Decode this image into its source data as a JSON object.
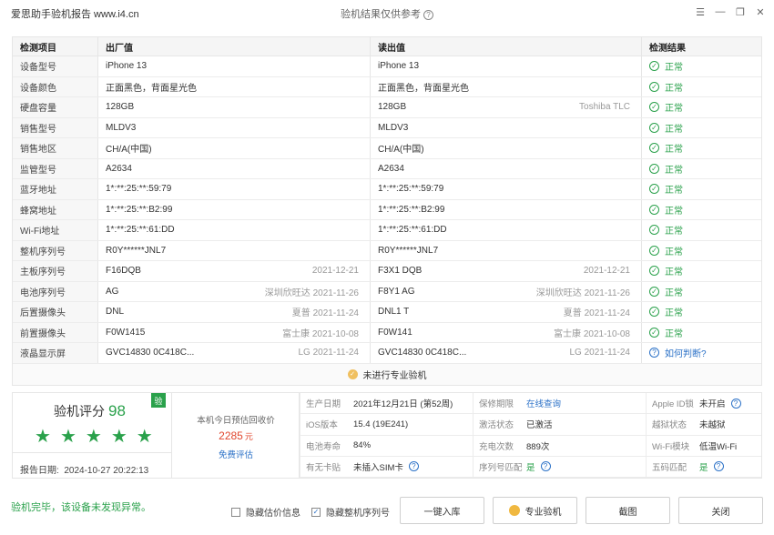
{
  "window": {
    "app_title": "爱思助手验机报告 www.i4.cn",
    "center_title": "验机结果仅供参考",
    "controls": [
      "☰",
      "—",
      "❐",
      "✕"
    ]
  },
  "table": {
    "headers": [
      "检测项目",
      "出厂值",
      "读出值",
      "检测结果"
    ],
    "rows": [
      {
        "item": "设备型号",
        "factory": "iPhone 13",
        "factory_extra": "",
        "read": "iPhone 13",
        "read_extra": "",
        "result": "正常"
      },
      {
        "item": "设备颜色",
        "factory": "正面黑色，背面星光色",
        "factory_extra": "",
        "read": "正面黑色，背面星光色",
        "read_extra": "",
        "result": "正常"
      },
      {
        "item": "硬盘容量",
        "factory": "128GB",
        "factory_extra": "",
        "read": "128GB",
        "read_extra": "Toshiba TLC",
        "result": "正常"
      },
      {
        "item": "销售型号",
        "factory": "MLDV3",
        "factory_extra": "",
        "read": "MLDV3",
        "read_extra": "",
        "result": "正常"
      },
      {
        "item": "销售地区",
        "factory": "CH/A(中国)",
        "factory_extra": "",
        "read": "CH/A(中国)",
        "read_extra": "",
        "result": "正常"
      },
      {
        "item": "监管型号",
        "factory": "A2634",
        "factory_extra": "",
        "read": "A2634",
        "read_extra": "",
        "result": "正常"
      },
      {
        "item": "蓝牙地址",
        "factory": "1*:**:25:**:59:79",
        "factory_extra": "",
        "read": "1*:**:25:**:59:79",
        "read_extra": "",
        "result": "正常"
      },
      {
        "item": "蜂窝地址",
        "factory": "1*:**:25:**:B2:99",
        "factory_extra": "",
        "read": "1*:**:25:**:B2:99",
        "read_extra": "",
        "result": "正常"
      },
      {
        "item": "Wi-Fi地址",
        "factory": "1*:**:25:**:61:DD",
        "factory_extra": "",
        "read": "1*:**:25:**:61:DD",
        "read_extra": "",
        "result": "正常"
      },
      {
        "item": "整机序列号",
        "factory": "R0Y******JNL7",
        "factory_extra": "",
        "read": "R0Y******JNL7",
        "read_extra": "",
        "result": "正常"
      },
      {
        "item": "主板序列号",
        "factory": "F16DQB",
        "factory_extra": "2021-12-21",
        "read": "F3X1 DQB",
        "read_extra": "2021-12-21",
        "result": "正常"
      },
      {
        "item": "电池序列号",
        "factory": "AG",
        "factory_extra": "深圳欣旺达 2021-11-26",
        "read": "F8Y1 AG",
        "read_extra": "深圳欣旺达 2021-11-26",
        "result": "正常"
      },
      {
        "item": "后置摄像头",
        "factory": "DNL",
        "factory_extra": "夏普 2021-11-24",
        "read": "DNL1 T",
        "read_extra": "夏普 2021-11-24",
        "result": "正常"
      },
      {
        "item": "前置摄像头",
        "factory": "F0W1415",
        "factory_extra": "富士康 2021-10-08",
        "read": "F0W141",
        "read_extra": "富士康 2021-10-08",
        "result": "正常"
      },
      {
        "item": "液晶显示屏",
        "factory": "GVC14830 0C418C...",
        "factory_extra": "LG 2021-11-24",
        "read": "GVC14830 0C418C...",
        "read_extra": "LG 2021-11-24",
        "result": "如何判断?",
        "result_type": "ask"
      }
    ],
    "footer": "未进行专业验机"
  },
  "score": {
    "label": "验机评分",
    "value": "98",
    "stars": 5,
    "badge": "验",
    "report_date_label": "报告日期:",
    "report_date": "2024-10-27 20:22:13"
  },
  "estimate": {
    "label": "本机今日预估回收价",
    "price": "2285",
    "unit": "元",
    "link": "免费评估"
  },
  "info": [
    {
      "label": "生产日期",
      "value": "2021年12月21日 (第52周)",
      "style": ""
    },
    {
      "label": "保修期限",
      "value": "在线查询",
      "style": "link"
    },
    {
      "label": "Apple ID锁",
      "value": "未开启",
      "style": "",
      "help": true
    },
    {
      "label": "iOS版本",
      "value": "15.4 (19E241)",
      "style": ""
    },
    {
      "label": "激活状态",
      "value": "已激活",
      "style": ""
    },
    {
      "label": "越狱状态",
      "value": "未越狱",
      "style": ""
    },
    {
      "label": "电池寿命",
      "value": "84%",
      "style": ""
    },
    {
      "label": "充电次数",
      "value": "889次",
      "style": ""
    },
    {
      "label": "Wi-Fi模块",
      "value": "低温Wi-Fi",
      "style": ""
    },
    {
      "label": "有无卡贴",
      "value": "未插入SIM卡",
      "style": "",
      "help": true
    },
    {
      "label": "序列号匹配",
      "value": "是",
      "style": "green",
      "help": true
    },
    {
      "label": "五码匹配",
      "value": "是",
      "style": "green",
      "help": true
    }
  ],
  "bottom": {
    "done_message": "验机完毕，该设备未发现异常。",
    "hide_estimate": "隐藏估价信息",
    "hide_serial": "隐藏整机序列号",
    "btn_store": "一键入库",
    "btn_pro": "专业验机",
    "btn_screenshot": "截图",
    "btn_close": "关闭"
  }
}
